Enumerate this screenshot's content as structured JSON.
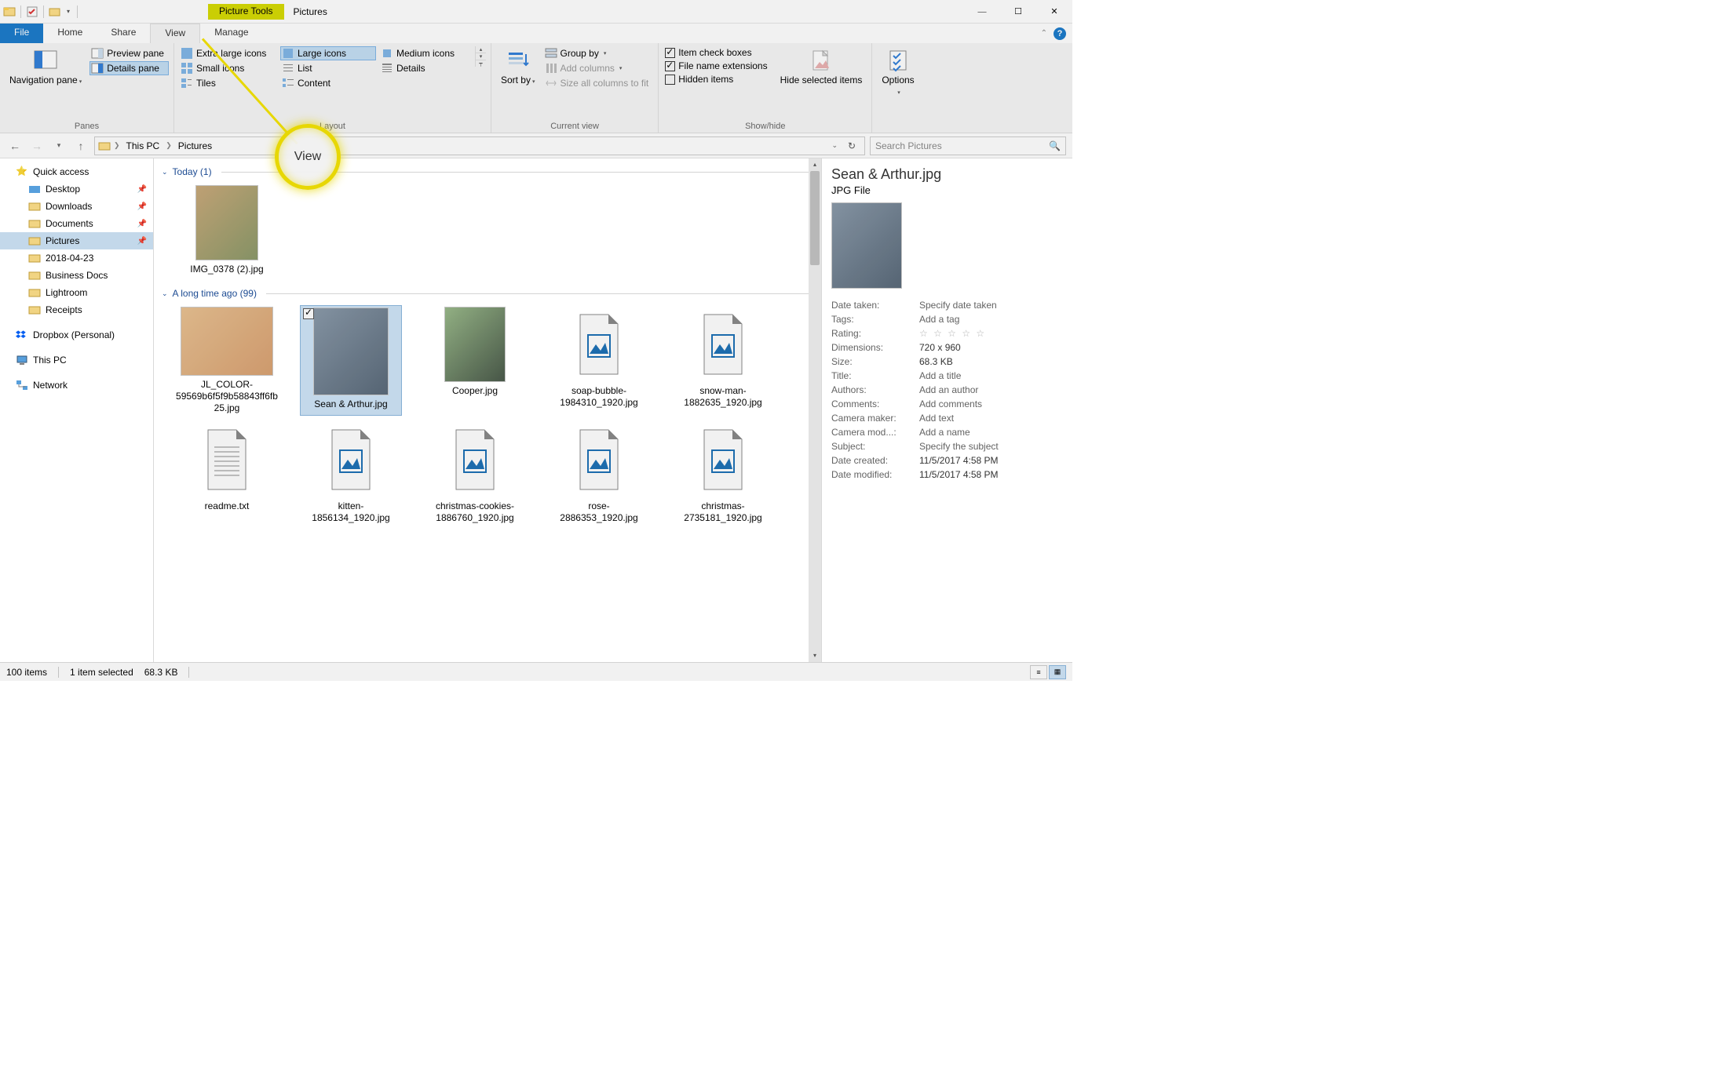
{
  "window": {
    "tool_tab": "Picture Tools",
    "title": "Pictures"
  },
  "tabs": {
    "file": "File",
    "home": "Home",
    "share": "Share",
    "view": "View",
    "manage": "Manage"
  },
  "ribbon": {
    "panes": {
      "navigation": "Navigation pane",
      "preview": "Preview pane",
      "details": "Details pane",
      "group": "Panes"
    },
    "layout": {
      "xlicons": "Extra large icons",
      "licons": "Large icons",
      "micons": "Medium icons",
      "sicons": "Small icons",
      "list": "List",
      "details": "Details",
      "tiles": "Tiles",
      "content": "Content"
    },
    "currentview": {
      "sortby": "Sort by",
      "groupby": "Group by",
      "addcols": "Add columns",
      "sizecols": "Size all columns to fit",
      "group": "Current view"
    },
    "showhide": {
      "itemcheck": "Item check boxes",
      "fileext": "File name extensions",
      "hidden": "Hidden items",
      "hidesel": "Hide selected items",
      "group": "Show/hide"
    },
    "options": "Options"
  },
  "address": {
    "thispc": "This PC",
    "pictures": "Pictures"
  },
  "search": {
    "placeholder": "Search Pictures"
  },
  "sidebar": {
    "quick": "Quick access",
    "desktop": "Desktop",
    "downloads": "Downloads",
    "documents": "Documents",
    "pictures": "Pictures",
    "f1": "2018-04-23",
    "f2": "Business Docs",
    "f3": "Lightroom",
    "f4": "Receipts",
    "dropbox": "Dropbox (Personal)",
    "thispc": "This PC",
    "network": "Network"
  },
  "groups": {
    "today": "Today (1)",
    "longago": "A long time ago (99)"
  },
  "files": {
    "f0": "IMG_0378 (2).jpg",
    "f1": "JL_COLOR-59569b6f5f9b58843ff6fb25.jpg",
    "f2": "Sean & Arthur.jpg",
    "f3": "Cooper.jpg",
    "f4": "soap-bubble-1984310_1920.jpg",
    "f5": "snow-man-1882635_1920.jpg",
    "f6": "readme.txt",
    "f7": "kitten-1856134_1920.jpg",
    "f8": "christmas-cookies-1886760_1920.jpg",
    "f9": "rose-2886353_1920.jpg",
    "f10": "christmas-2735181_1920.jpg"
  },
  "details": {
    "title": "Sean & Arthur.jpg",
    "type": "JPG File",
    "rows": {
      "datetaken_l": "Date taken:",
      "datetaken_v": "Specify date taken",
      "tags_l": "Tags:",
      "tags_v": "Add a tag",
      "rating_l": "Rating:",
      "dim_l": "Dimensions:",
      "dim_v": "720 x 960",
      "size_l": "Size:",
      "size_v": "68.3 KB",
      "title_l": "Title:",
      "title_v": "Add a title",
      "authors_l": "Authors:",
      "authors_v": "Add an author",
      "comments_l": "Comments:",
      "comments_v": "Add comments",
      "cammaker_l": "Camera maker:",
      "cammaker_v": "Add text",
      "cammodel_l": "Camera mod...:",
      "cammodel_v": "Add a name",
      "subject_l": "Subject:",
      "subject_v": "Specify the subject",
      "created_l": "Date created:",
      "created_v": "11/5/2017 4:58 PM",
      "modified_l": "Date modified:",
      "modified_v": "11/5/2017 4:58 PM"
    }
  },
  "status": {
    "count": "100 items",
    "sel": "1 item selected",
    "size": "68.3 KB"
  },
  "callout": {
    "label": "View"
  }
}
